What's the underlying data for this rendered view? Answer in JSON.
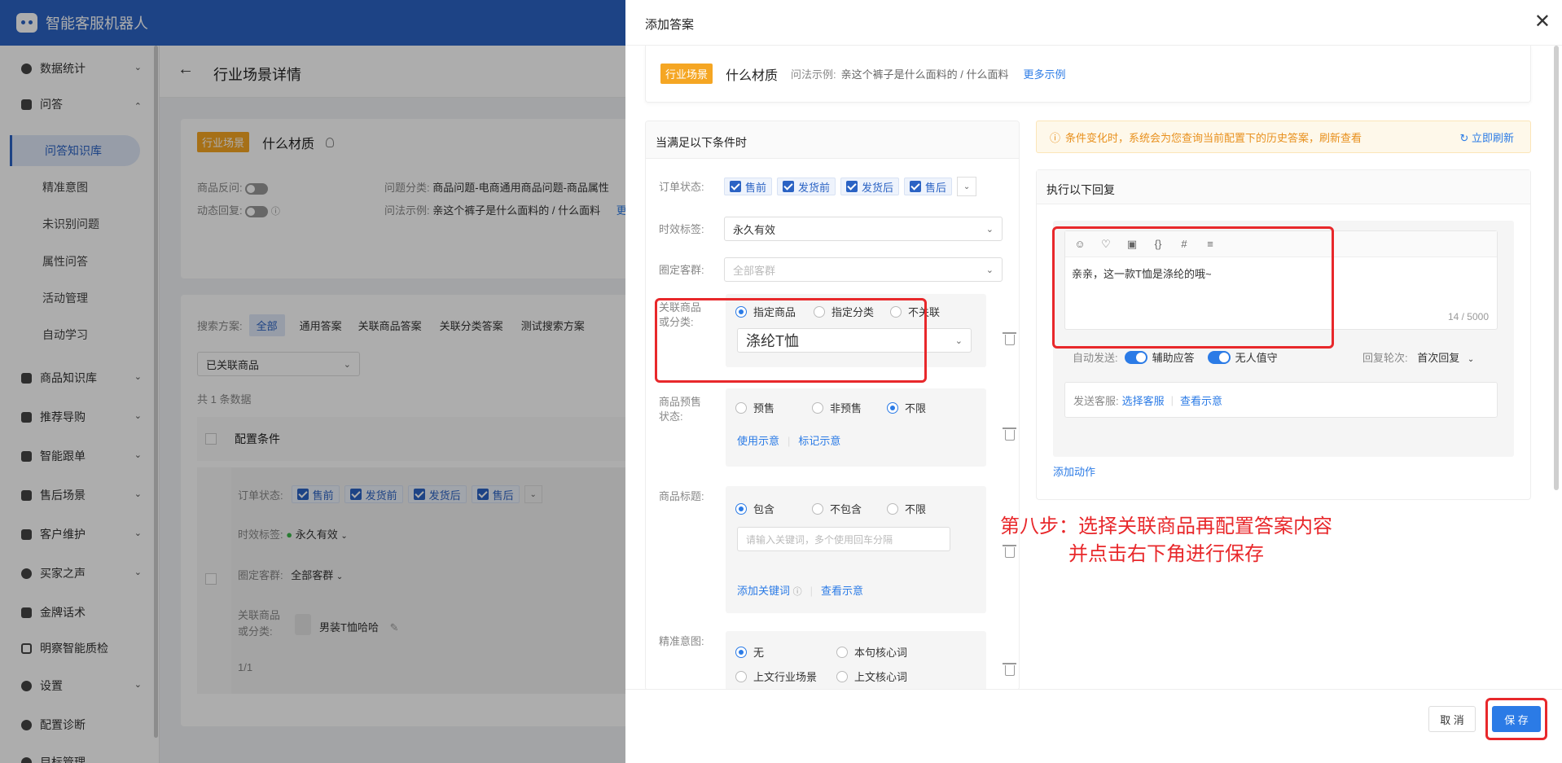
{
  "app": {
    "title": "智能客服机器人"
  },
  "sidebar": {
    "items": [
      {
        "label": "数据统计"
      },
      {
        "label": "问答"
      },
      {
        "label": "问答知识库"
      },
      {
        "label": "精准意图"
      },
      {
        "label": "未识别问题"
      },
      {
        "label": "属性问答"
      },
      {
        "label": "活动管理"
      },
      {
        "label": "自动学习"
      },
      {
        "label": "商品知识库"
      },
      {
        "label": "推荐导购"
      },
      {
        "label": "智能跟单"
      },
      {
        "label": "售后场景"
      },
      {
        "label": "客户维护"
      },
      {
        "label": "买家之声"
      },
      {
        "label": "金牌话术"
      },
      {
        "label": "明察智能质检"
      },
      {
        "label": "设置"
      },
      {
        "label": "配置诊断"
      },
      {
        "label": "目标管理"
      }
    ]
  },
  "page": {
    "title": "行业场景详情",
    "scene_tag": "行业场景",
    "question": "什么材质",
    "product_reverse_label": "商品反问:",
    "dynamic_reply_label": "动态回复:",
    "question_category_label": "问题分类:",
    "question_category": "商品问题-电商通用商品问题-商品属性",
    "question_example_label": "问法示例:",
    "question_example": "亲这个裤子是什么面料的 / 什么面料",
    "question_example_more": "更",
    "search_label": "搜索方案:",
    "search_tabs": [
      "全部",
      "通用答案",
      "关联商品答案",
      "关联分类答案",
      "测试搜索方案"
    ],
    "filter_select": "已关联商品",
    "total": "共 1 条数据",
    "table_header": "配置条件",
    "row": {
      "order_status_label": "订单状态:",
      "chips": [
        "售前",
        "发货前",
        "发货后",
        "售后"
      ],
      "time_tag_label": "时效标签:",
      "time_tag": "永久有效",
      "customer_group_label": "圈定客群:",
      "customer_group": "全部客群",
      "related_label_1": "关联商品",
      "related_label_2": "或分类:",
      "product_name": "男装T恤哈哈"
    },
    "pagination": "1/1"
  },
  "drawer": {
    "title": "添加答案",
    "scene_tag": "行业场景",
    "question": "什么材质",
    "example_label": "问法示例:",
    "example": "亲这个裤子是什么面料的 / 什么面料",
    "more": "更多示例",
    "left": {
      "header": "当满足以下条件时",
      "order_status_label": "订单状态:",
      "order_chips": [
        "售前",
        "发货前",
        "发货后",
        "售后"
      ],
      "time_tag_label": "时效标签:",
      "time_tag": "永久有效",
      "customer_label": "圈定客群:",
      "customer_placeholder": "全部客群",
      "related_label_1": "关联商品",
      "related_label_2": "或分类:",
      "related_options": [
        "指定商品",
        "指定分类",
        "不关联"
      ],
      "related_value": "涤纶T恤",
      "presale_label_1": "商品预售",
      "presale_label_2": "状态:",
      "presale_options": [
        "预售",
        "非预售",
        "不限"
      ],
      "presale_links": [
        "使用示意",
        "标记示意"
      ],
      "title_label": "商品标题:",
      "title_options": [
        "包含",
        "不包含",
        "不限"
      ],
      "title_placeholder": "请输入关键词，多个使用回车分隔",
      "title_links": [
        "添加关键词",
        "查看示意"
      ],
      "intent_label": "精准意图:",
      "intent_options": [
        "无",
        "本句核心词",
        "上文行业场景",
        "上文核心词"
      ]
    },
    "right": {
      "notice": "条件变化时，系统会为您查询当前配置下的历史答案，刷新查看",
      "refresh": "立即刷新",
      "header": "执行以下回复",
      "reply_text": "亲亲，这一款T恤是涤纶的哦~",
      "char_count": "14 / 5000",
      "auto_send_label": "自动发送:",
      "assist": "辅助应答",
      "unattended": "无人值守",
      "rounds_label": "回复轮次:",
      "rounds_value": "首次回复",
      "send_agent_label": "发送客服:",
      "choose_agent": "选择客服",
      "view_demo": "查看示意",
      "add_action": "添加动作"
    },
    "annotation_line1": "第八步：选择关联商品再配置答案内容",
    "annotation_line2": "并点击右下角进行保存",
    "cancel": "取 消",
    "save": "保 存"
  },
  "colors": {
    "primary": "#2b63c4",
    "link": "#2b7be6",
    "tag": "#f5a623",
    "annotation": "#e8282b"
  }
}
